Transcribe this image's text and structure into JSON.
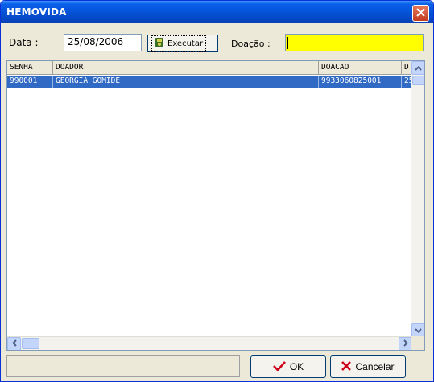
{
  "window": {
    "title": "HEMOVIDA",
    "close_icon": "close-icon"
  },
  "toolbar": {
    "date_label": "Data :",
    "date_value": "25/08/2006",
    "execute_label": "Executar",
    "execute_icon": "execute-icon",
    "doacao_label": "Doação :",
    "doacao_value": "",
    "doacao_color": "#ffff00"
  },
  "grid": {
    "columns": [
      "SENHA",
      "DOADOR",
      "DOACAO",
      "DT"
    ],
    "rows": [
      {
        "senha": "990001",
        "doador": "GEORGIA GOMIDE",
        "doacao": "9933060825001",
        "dt": "25"
      }
    ],
    "selected_row_color": "#316ac5"
  },
  "footer": {
    "status_text": "",
    "ok_label": "OK",
    "ok_icon": "checkmark-icon",
    "cancel_label": "Cancelar",
    "cancel_icon": "cancel-x-icon"
  }
}
